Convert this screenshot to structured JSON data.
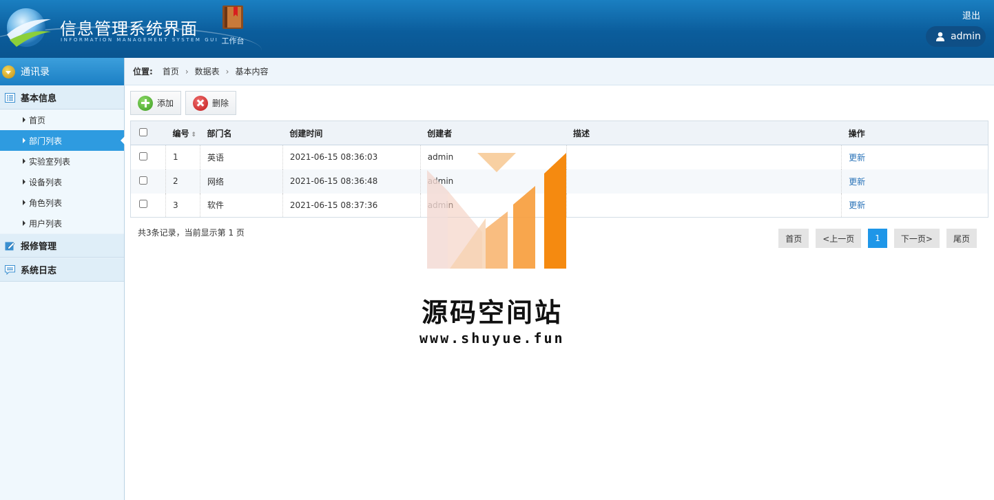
{
  "header": {
    "title": "信息管理系统界面",
    "subtitle": "INFORMATION MANAGEMENT SYSTEM GUI",
    "workbench_label": "工作台",
    "logout_label": "退出",
    "user_name": "admin"
  },
  "sidebar": {
    "top_label": "通讯录",
    "groups": [
      {
        "label": "基本信息",
        "icon": "list-icon"
      },
      {
        "label": "报修管理",
        "icon": "edit-icon"
      },
      {
        "label": "系统日志",
        "icon": "chat-icon"
      }
    ],
    "items": [
      {
        "label": "首页"
      },
      {
        "label": "部门列表",
        "active": true
      },
      {
        "label": "实验室列表"
      },
      {
        "label": "设备列表"
      },
      {
        "label": "角色列表"
      },
      {
        "label": "用户列表"
      }
    ]
  },
  "breadcrumb": {
    "prefix": "位置:",
    "items": [
      "首页",
      "数据表",
      "基本内容"
    ],
    "separator": "›"
  },
  "toolbar": {
    "add_label": "添加",
    "delete_label": "删除"
  },
  "table": {
    "headers": [
      "编号",
      "部门名",
      "创建时间",
      "创建者",
      "描述",
      "操作"
    ],
    "rows": [
      {
        "id": "1",
        "name": "英语",
        "created": "2021-06-15 08:36:03",
        "creator": "admin",
        "desc": "",
        "action": "更新"
      },
      {
        "id": "2",
        "name": "网络",
        "created": "2021-06-15 08:36:48",
        "creator": "admin",
        "desc": "",
        "action": "更新"
      },
      {
        "id": "3",
        "name": "软件",
        "created": "2021-06-15 08:37:36",
        "creator": "admin",
        "desc": "",
        "action": "更新"
      }
    ]
  },
  "footer": {
    "summary": "共3条记录，当前显示第 1 页",
    "pager": {
      "first": "首页",
      "prev": "<上一页",
      "current": "1",
      "next": "下一页>",
      "last": "尾页"
    }
  },
  "watermark": {
    "title": "源码空间站",
    "url": "www.shuyue.fun"
  },
  "colors": {
    "header_blue": "#0b5d9c",
    "active_item": "#2e9be0",
    "current_page": "#1e96e8"
  }
}
